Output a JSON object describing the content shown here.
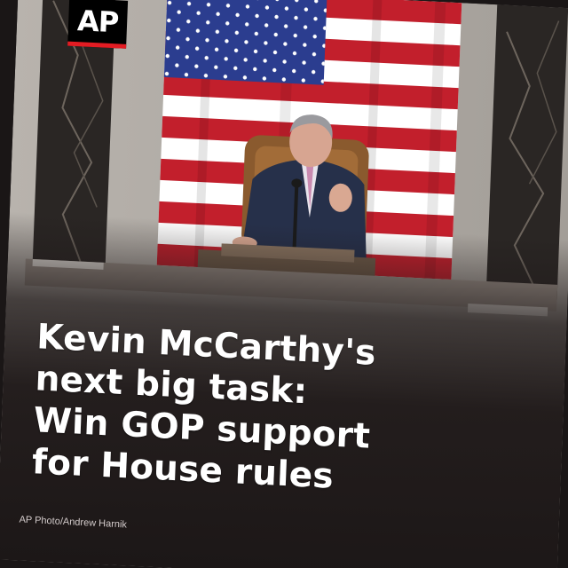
{
  "logo": {
    "text": "AP"
  },
  "headline": {
    "lines": [
      "Kevin McCarthy's",
      "next big task:",
      "Win GOP support",
      "for House rules"
    ]
  },
  "credit": "AP Photo/Andrew Harnik",
  "colors": {
    "logo_accent": "#e31c23",
    "flag_red": "#c21f2c",
    "flag_blue": "#2b3d8f",
    "overlay": "#1c1717"
  }
}
